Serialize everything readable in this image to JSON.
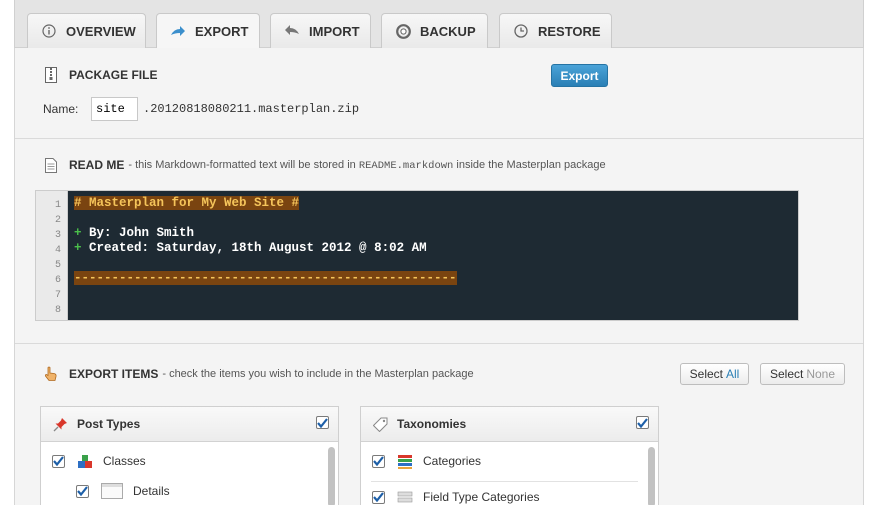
{
  "tabs": [
    {
      "label": "OVERVIEW",
      "icon": "info-icon"
    },
    {
      "label": "EXPORT",
      "icon": "export-arrow-icon",
      "active": true
    },
    {
      "label": "IMPORT",
      "icon": "import-arrow-icon"
    },
    {
      "label": "BACKUP",
      "icon": "lifebuoy-icon"
    },
    {
      "label": "RESTORE",
      "icon": "clock-icon"
    }
  ],
  "package": {
    "title": "PACKAGE FILE",
    "export_label": "Export",
    "name_label": "Name:",
    "name_value": "site",
    "name_suffix": ".20120818080211.masterplan.zip"
  },
  "readme": {
    "title": "READ ME",
    "desc_pre": "- this Markdown-formatted text will be stored in",
    "desc_file": "README.markdown",
    "desc_post": "inside the Masterplan package",
    "line_numbers": [
      "1",
      "2",
      "3",
      "4",
      "5",
      "6",
      "7",
      "8"
    ],
    "lines": [
      "# Masterplan for My Web Site #",
      "",
      "+ By: John Smith",
      "+ Created: Saturday, 18th August 2012 @ 8:02 AM",
      "",
      "---------------------------------------------------",
      "",
      ""
    ]
  },
  "export_items": {
    "title": "EXPORT ITEMS",
    "desc": "- check the items you wish to include in the Masterplan package",
    "select_all": {
      "pre": "Select",
      "accent": "All"
    },
    "select_none": {
      "pre": "Select",
      "muted": "None"
    }
  },
  "post_types": {
    "title": "Post Types",
    "items": [
      {
        "label": "Classes",
        "checked": true
      },
      {
        "label": "Details",
        "checked": true
      }
    ]
  },
  "taxonomies": {
    "title": "Taxonomies",
    "items": [
      {
        "label": "Categories",
        "checked": true
      },
      {
        "label": "Field Type Categories",
        "checked": true
      }
    ]
  },
  "colors": {
    "accent": "#2a7fb5",
    "code_bg": "#1e2a33",
    "highlight_bg": "#7a4410",
    "highlight_fg": "#f5c45a"
  }
}
